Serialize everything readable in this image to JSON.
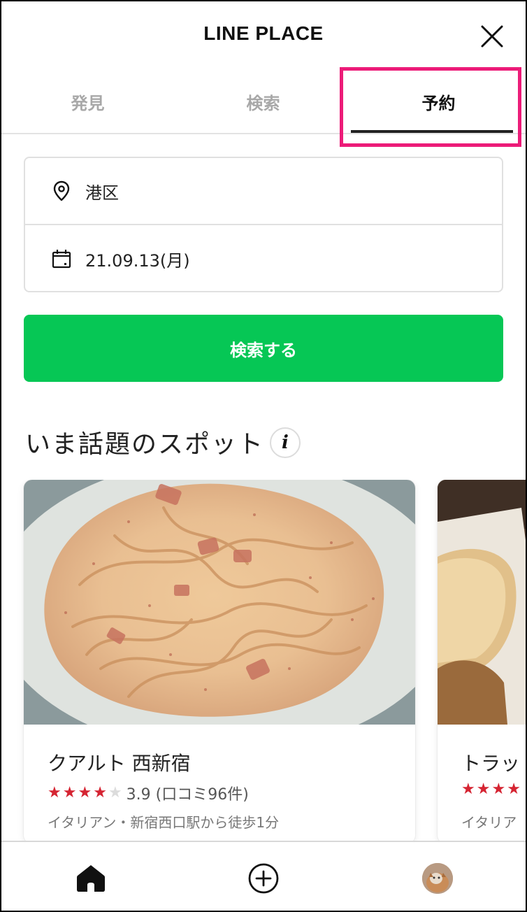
{
  "header": {
    "title": "LINE PLACE",
    "close_icon": "close-icon"
  },
  "tabs": [
    {
      "label": "発見",
      "active": false
    },
    {
      "label": "検索",
      "active": false
    },
    {
      "label": "予約",
      "active": true
    }
  ],
  "search": {
    "location": {
      "icon": "location-pin-icon",
      "value": "港区"
    },
    "date": {
      "icon": "calendar-icon",
      "value": "21.09.13(月)"
    },
    "button_label": "検索する"
  },
  "section": {
    "title": "いま話題のスポット",
    "info_icon": "i"
  },
  "spots": [
    {
      "name": "クアルト 西新宿",
      "rating": 3.9,
      "rating_text": "3.9 (口コミ96件)",
      "filled_stars": 4,
      "meta": "イタリアン・新宿西口駅から徒歩1分",
      "photo": "carbonara-pasta-photo"
    },
    {
      "name": "トラッ",
      "filled_stars": 4,
      "meta": "イタリア",
      "photo": "bread-photo"
    }
  ],
  "bottom_nav": {
    "items": [
      {
        "icon": "home-icon",
        "active": true
      },
      {
        "icon": "add-circle-icon",
        "active": false
      },
      {
        "icon": "profile-avatar",
        "active": false
      }
    ]
  },
  "colors": {
    "accent": "#06c755",
    "highlight": "#ec1b78",
    "star": "#d52432"
  }
}
